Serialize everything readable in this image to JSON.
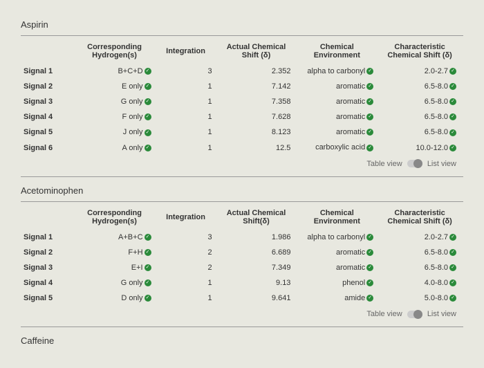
{
  "sections": [
    {
      "title": "Aspirin",
      "headers": [
        "",
        "Corresponding Hydrogen(s)",
        "Integration",
        "Actual Chemical Shift (δ)",
        "Chemical Environment",
        "Characteristic Chemical Shift (δ)"
      ],
      "rows": [
        {
          "sig": "Signal 1",
          "hyd": "B+C+D",
          "int": "3",
          "shift": "2.352",
          "env": "alpha to carbonyl",
          "char": "2.0-2.7"
        },
        {
          "sig": "Signal 2",
          "hyd": "E only",
          "int": "1",
          "shift": "7.142",
          "env": "aromatic",
          "char": "6.5-8.0"
        },
        {
          "sig": "Signal 3",
          "hyd": "G only",
          "int": "1",
          "shift": "7.358",
          "env": "aromatic",
          "char": "6.5-8.0"
        },
        {
          "sig": "Signal 4",
          "hyd": "F only",
          "int": "1",
          "shift": "7.628",
          "env": "aromatic",
          "char": "6.5-8.0"
        },
        {
          "sig": "Signal 5",
          "hyd": "J only",
          "int": "1",
          "shift": "8.123",
          "env": "aromatic",
          "char": "6.5-8.0"
        },
        {
          "sig": "Signal 6",
          "hyd": "A only",
          "int": "1",
          "shift": "12.5",
          "env": "carboxylic acid",
          "char": "10.0-12.0"
        }
      ],
      "toggle": {
        "left": "Table view",
        "right": "List view"
      }
    },
    {
      "title": "Acetominophen",
      "headers": [
        "",
        "Corresponding Hydrogen(s)",
        "Integration",
        "Actual Chemical Shift(δ)",
        "Chemical Environment",
        "Characteristic Chemical Shift (δ)"
      ],
      "rows": [
        {
          "sig": "Signal 1",
          "hyd": "A+B+C",
          "int": "3",
          "shift": "1.986",
          "env": "alpha to carbonyl",
          "char": "2.0-2.7"
        },
        {
          "sig": "Signal 2",
          "hyd": "F+H",
          "int": "2",
          "shift": "6.689",
          "env": "aromatic",
          "char": "6.5-8.0"
        },
        {
          "sig": "Signal 3",
          "hyd": "E+I",
          "int": "2",
          "shift": "7.349",
          "env": "aromatic",
          "char": "6.5-8.0"
        },
        {
          "sig": "Signal 4",
          "hyd": "G only",
          "int": "1",
          "shift": "9.13",
          "env": "phenol",
          "char": "4.0-8.0"
        },
        {
          "sig": "Signal 5",
          "hyd": "D only",
          "int": "1",
          "shift": "9.641",
          "env": "amide",
          "char": "5.0-8.0"
        }
      ],
      "toggle": {
        "left": "Table view",
        "right": "List view"
      }
    },
    {
      "title": "Caffeine",
      "headers": [],
      "rows": [],
      "toggle": null
    }
  ]
}
